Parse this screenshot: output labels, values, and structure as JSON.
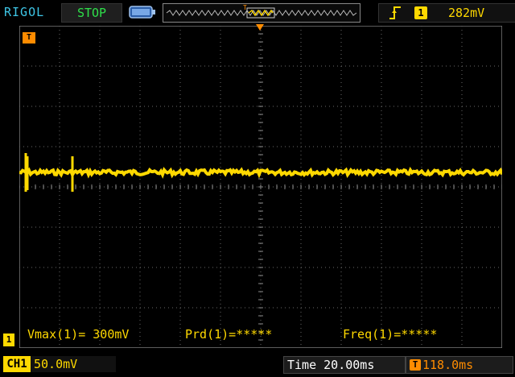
{
  "header": {
    "brand": "RIGOL",
    "run_state": "STOP",
    "trigger_level": "282mV",
    "trigger_channel": "1",
    "trigger_edge_icon": "rising-edge-icon"
  },
  "screen": {
    "trigger_marker_label": "T",
    "channel_ground_marker": "1"
  },
  "measurements": {
    "vmax": "Vmax(1)= 300mV",
    "period": "Prd(1)=*****",
    "frequency": "Freq(1)=*****"
  },
  "footer": {
    "channel_label": "CH1",
    "volts_per_div": "50.0mV",
    "timebase": "Time 20.00ms",
    "trigger_delay": "118.0ms",
    "trigger_delay_icon": "T"
  },
  "colors": {
    "channel1": "#ffd900",
    "trigger": "#ff8c00",
    "brand": "#3ec6e6",
    "run_state": "#2ee04a",
    "grid": "#6a6a6a"
  }
}
